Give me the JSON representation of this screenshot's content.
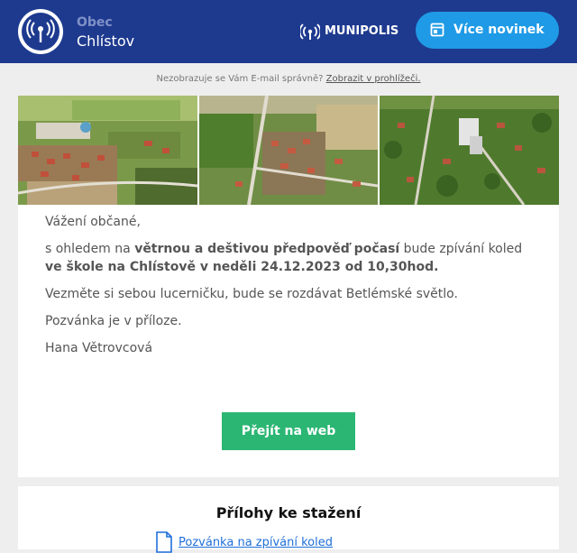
{
  "header": {
    "org_small": "Obec",
    "org_name": "Chlístov",
    "brand": "MUNIPOLIS",
    "more_button": "Více novinek"
  },
  "preheader": {
    "text": "Nezobrazuje se Vám E-mail správně?",
    "link": "Zobrazit v prohlížeči."
  },
  "message": {
    "greeting": "Vážení občané,",
    "p1_a": "s ohledem na ",
    "p1_b": "větrnou a deštivou předpověď počasí",
    "p1_c": " bude zpívání koled ",
    "p1_d": "ve škole na Chlístově  v neděli 24.12.2023 od 10,30hod.",
    "p2": "Vezměte si sebou lucerničku, bude se rozdávat Betlémské světlo.",
    "p3": "Pozvánka je v příloze.",
    "signature": "Hana Větrovcová"
  },
  "cta": {
    "label": "Přejít na web"
  },
  "attachments": {
    "title": "Přílohy ke stažení",
    "file": "Pozvánka na zpívání koled"
  },
  "colors": {
    "header_bg": "#1e3a8f",
    "accent_blue": "#1f9ae6",
    "cta_green": "#2bb673"
  }
}
